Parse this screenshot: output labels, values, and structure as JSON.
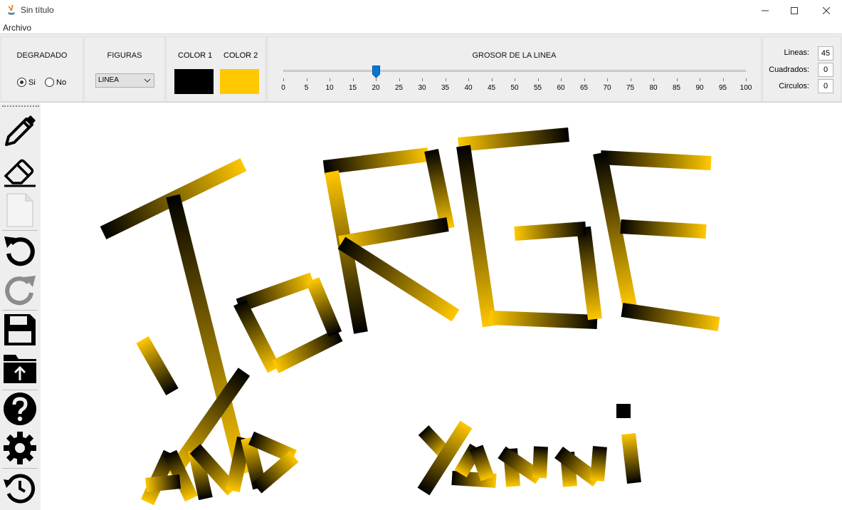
{
  "window": {
    "title": "Sin título"
  },
  "menu": {
    "archivo": "Archivo"
  },
  "degradado": {
    "title": "DEGRADADO",
    "options": [
      "Si",
      "No"
    ],
    "selected": "Si"
  },
  "figuras": {
    "title": "FIGURAS",
    "selected": "LINEA"
  },
  "colors": {
    "color1_label": "COLOR 1",
    "color2_label": "COLOR 2",
    "color1": "#000000",
    "color2": "#ffc800"
  },
  "grosor": {
    "title": "GROSOR DE LA LINEA",
    "value": 20,
    "min": 0,
    "max": 100,
    "ticks": [
      "0",
      "5",
      "10",
      "15",
      "20",
      "25",
      "30",
      "35",
      "40",
      "45",
      "50",
      "55",
      "60",
      "65",
      "70",
      "75",
      "80",
      "85",
      "90",
      "95",
      "100"
    ]
  },
  "counts": {
    "lineas_label": "Lineas:",
    "lineas": "45",
    "cuadrados_label": "Cuadrados:",
    "cuadrados": "0",
    "circulos_label": "Circulos:",
    "circulos": "0"
  },
  "tools": [
    "pencil-icon",
    "eraser-icon",
    "new-file-icon",
    "undo-icon",
    "redo-icon",
    "save-icon",
    "open-folder-icon",
    "help-icon",
    "settings-icon",
    "history-icon"
  ],
  "accent": "#0078d7"
}
